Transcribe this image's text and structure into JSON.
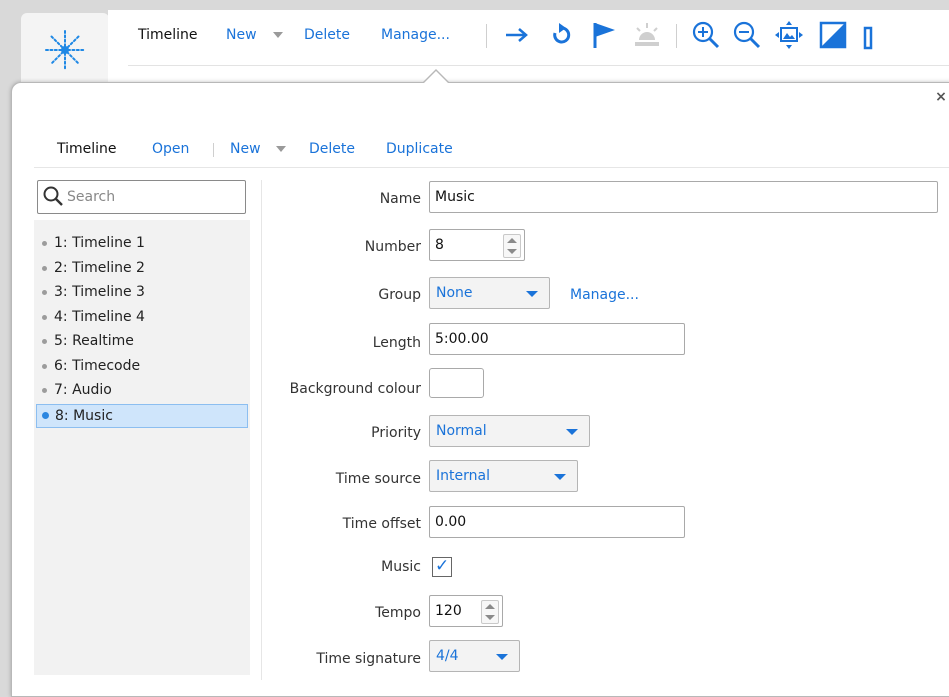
{
  "toolbar": {
    "title": "Timeline",
    "new_label": "New",
    "delete_label": "Delete",
    "manage_label": "Manage..."
  },
  "subtoolbar": {
    "title": "Timeline",
    "open_label": "Open",
    "new_label": "New",
    "delete_label": "Delete",
    "duplicate_label": "Duplicate"
  },
  "search": {
    "placeholder": "Search",
    "value": ""
  },
  "timelines": [
    {
      "label": "1: Timeline 1"
    },
    {
      "label": "2: Timeline 2"
    },
    {
      "label": "3: Timeline 3"
    },
    {
      "label": "4: Timeline 4"
    },
    {
      "label": "5: Realtime"
    },
    {
      "label": "6: Timecode"
    },
    {
      "label": "7: Audio"
    },
    {
      "label": "8: Music"
    }
  ],
  "form": {
    "name_label": "Name",
    "name_value": "Music",
    "number_label": "Number",
    "number_value": "8",
    "group_label": "Group",
    "group_value": "None",
    "group_manage": "Manage...",
    "length_label": "Length",
    "length_value": "5:00.00",
    "bg_colour_label": "Background colour",
    "bg_colour_value": "#ffffff",
    "priority_label": "Priority",
    "priority_value": "Normal",
    "time_source_label": "Time source",
    "time_source_value": "Internal",
    "time_offset_label": "Time offset",
    "time_offset_value": "0.00",
    "music_label": "Music",
    "music_checked": true,
    "tempo_label": "Tempo",
    "tempo_value": "120",
    "time_signature_label": "Time signature",
    "time_signature_value": "4/4"
  },
  "colors": {
    "accent": "#1a73d9",
    "selection": "#cfe5fb",
    "logo": "#1e88e5"
  }
}
